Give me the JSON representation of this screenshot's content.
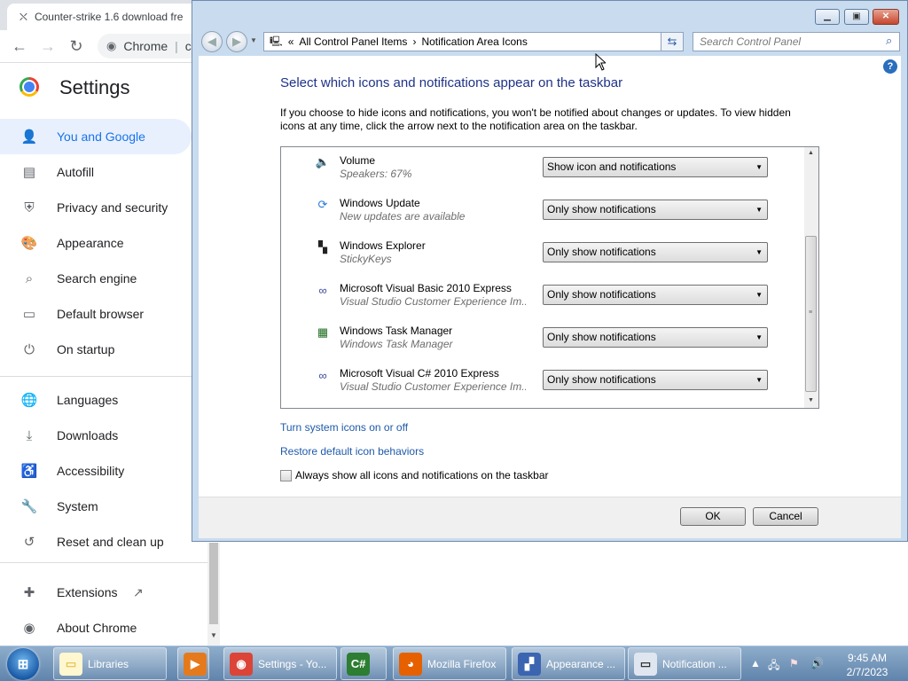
{
  "chrome": {
    "tab_title": "Counter-strike 1.6 download fre",
    "omnibox_label": "Chrome",
    "omnibox_sep": "c",
    "settings_title": "Settings",
    "sidebar": [
      {
        "label": "You and Google",
        "icon": "person-icon"
      },
      {
        "label": "Autofill",
        "icon": "clipboard-icon"
      },
      {
        "label": "Privacy and security",
        "icon": "shield-icon"
      },
      {
        "label": "Appearance",
        "icon": "palette-icon"
      },
      {
        "label": "Search engine",
        "icon": "search-icon"
      },
      {
        "label": "Default browser",
        "icon": "browser-icon"
      },
      {
        "label": "On startup",
        "icon": "power-icon"
      },
      {
        "label": "Languages",
        "icon": "globe-icon"
      },
      {
        "label": "Downloads",
        "icon": "download-icon"
      },
      {
        "label": "Accessibility",
        "icon": "accessibility-icon"
      },
      {
        "label": "System",
        "icon": "wrench-icon"
      },
      {
        "label": "Reset and clean up",
        "icon": "history-icon"
      },
      {
        "label": "Extensions",
        "icon": "puzzle-icon"
      },
      {
        "label": "About Chrome",
        "icon": "chrome-icon"
      }
    ]
  },
  "control_panel": {
    "breadcrumb": {
      "root_marker": "«",
      "item1": "All Control Panel Items",
      "sep": "›",
      "item2": "Notification Area Icons"
    },
    "search_placeholder": "Search Control Panel",
    "heading": "Select which icons and notifications appear on the taskbar",
    "description": "If you choose to hide icons and notifications, you won't be notified about changes or updates. To view hidden icons at any time, click the arrow next to the notification area on the taskbar.",
    "items": [
      {
        "name": "Volume",
        "sub": "Speakers: 67%",
        "behavior": "Show icon and notifications",
        "icon": "speaker-icon"
      },
      {
        "name": "Windows Update",
        "sub": "New updates are available",
        "behavior": "Only show notifications",
        "icon": "windows-update-icon"
      },
      {
        "name": "Windows Explorer",
        "sub": "StickyKeys",
        "behavior": "Only show notifications",
        "icon": "explorer-icon"
      },
      {
        "name": "Microsoft Visual Basic 2010 Express",
        "sub": "Visual Studio Customer Experience Im...",
        "behavior": "Only show notifications",
        "icon": "visual-studio-icon"
      },
      {
        "name": "Windows Task Manager",
        "sub": "Windows Task Manager",
        "behavior": "Only show notifications",
        "icon": "task-manager-icon"
      },
      {
        "name": "Microsoft Visual C# 2010 Express",
        "sub": "Visual Studio Customer Experience Im...",
        "behavior": "Only show notifications",
        "icon": "visual-studio-icon"
      }
    ],
    "link_system_icons": "Turn system icons on or off",
    "link_restore": "Restore default icon behaviors",
    "checkbox_label": "Always show all icons and notifications on the taskbar",
    "ok_label": "OK",
    "cancel_label": "Cancel"
  },
  "taskbar": {
    "buttons": [
      {
        "label": "Libraries",
        "icon": "folder-icon"
      },
      {
        "label": "",
        "icon": "media-player-icon"
      },
      {
        "label": "Settings - Yo...",
        "icon": "chrome-icon"
      },
      {
        "label": "",
        "icon": "csharp-icon"
      },
      {
        "label": "Mozilla Firefox",
        "icon": "firefox-icon"
      },
      {
        "label": "Appearance ...",
        "icon": "display-settings-icon"
      },
      {
        "label": "Notification ...",
        "icon": "notification-area-icon"
      }
    ],
    "clock_time": "9:45 AM",
    "clock_date": "2/7/2023"
  }
}
